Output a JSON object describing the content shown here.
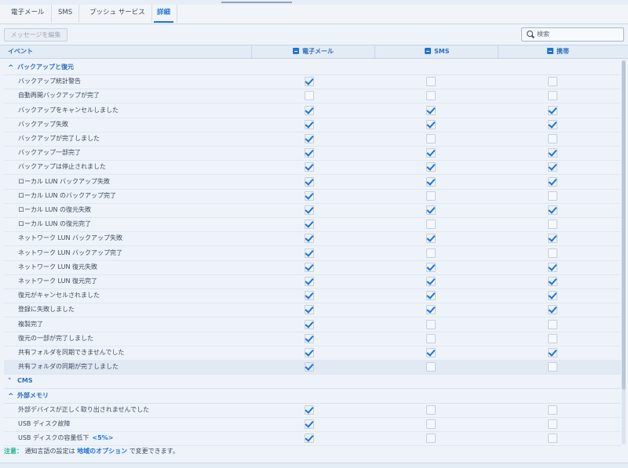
{
  "tabs": [
    {
      "label": "電子メール",
      "active": false
    },
    {
      "label": "SMS",
      "active": false
    },
    {
      "label": "プッシュ サービス",
      "active": false
    },
    {
      "label": "詳細",
      "active": true
    }
  ],
  "toolbar": {
    "edit_label": "メッセージを編集",
    "search_placeholder": "検索"
  },
  "columns": {
    "event": "イベント",
    "email": "電子メール",
    "sms": "SMS",
    "mobile": "携帯"
  },
  "groups": [
    {
      "label": "バックアップと復元",
      "expanded": true,
      "rows": [
        {
          "label": "バックアップ統計警告",
          "email": true,
          "sms": false,
          "mobile": false
        },
        {
          "label": "自動再開バックアップが完了",
          "email": false,
          "sms": false,
          "mobile": false
        },
        {
          "label": "バックアップをキャンセルしました",
          "email": true,
          "sms": true,
          "mobile": true
        },
        {
          "label": "バックアップ失敗",
          "email": true,
          "sms": true,
          "mobile": true
        },
        {
          "label": "バックアップが完了しました",
          "email": true,
          "sms": false,
          "mobile": false
        },
        {
          "label": "バックアップ一部完了",
          "email": true,
          "sms": true,
          "mobile": true
        },
        {
          "label": "バックアップは停止されました",
          "email": true,
          "sms": true,
          "mobile": true
        },
        {
          "label": "ローカル LUN バックアップ失敗",
          "email": true,
          "sms": true,
          "mobile": true
        },
        {
          "label": "ローカル LUN のバックアップ完了",
          "email": true,
          "sms": false,
          "mobile": false
        },
        {
          "label": "ローカル LUN の復元失敗",
          "email": true,
          "sms": true,
          "mobile": true
        },
        {
          "label": "ローカル LUN の復元完了",
          "email": true,
          "sms": false,
          "mobile": false
        },
        {
          "label": "ネットワーク LUN バックアップ失敗",
          "email": true,
          "sms": true,
          "mobile": true
        },
        {
          "label": "ネットワーク LUN バックアップ完了",
          "email": true,
          "sms": false,
          "mobile": false
        },
        {
          "label": "ネットワーク LUN 復元失敗",
          "email": true,
          "sms": true,
          "mobile": true
        },
        {
          "label": "ネットワーク LUN 復元完了",
          "email": true,
          "sms": true,
          "mobile": true
        },
        {
          "label": "復元がキャンセルされました",
          "email": true,
          "sms": true,
          "mobile": true
        },
        {
          "label": "登録に失敗しました",
          "email": true,
          "sms": true,
          "mobile": true
        },
        {
          "label": "複製完了",
          "email": true,
          "sms": false,
          "mobile": false
        },
        {
          "label": "復元の一部が完了しました",
          "email": true,
          "sms": false,
          "mobile": false
        },
        {
          "label": "共有フォルダを同期できませんでした",
          "email": true,
          "sms": true,
          "mobile": true
        },
        {
          "label": "共有フォルダの同期が完了しました",
          "email": true,
          "sms": false,
          "mobile": false,
          "highlighted": true
        }
      ]
    },
    {
      "label": "CMS",
      "expanded": false,
      "rows": []
    },
    {
      "label": "外部メモリ",
      "expanded": true,
      "rows": [
        {
          "label": "外部デバイスが正しく取り出されませんでした",
          "email": true,
          "sms": false,
          "mobile": false
        },
        {
          "label": "USB ディスク故障",
          "email": true,
          "sms": false,
          "mobile": false
        },
        {
          "label": "USB ディスクの容量低下",
          "link": "<5%>",
          "email": true,
          "sms": false,
          "mobile": false
        }
      ]
    }
  ],
  "note": {
    "prefix": "注意：",
    "text1": "通知言語の設定は",
    "link": "地域のオプション",
    "text2": "で変更できます。"
  }
}
